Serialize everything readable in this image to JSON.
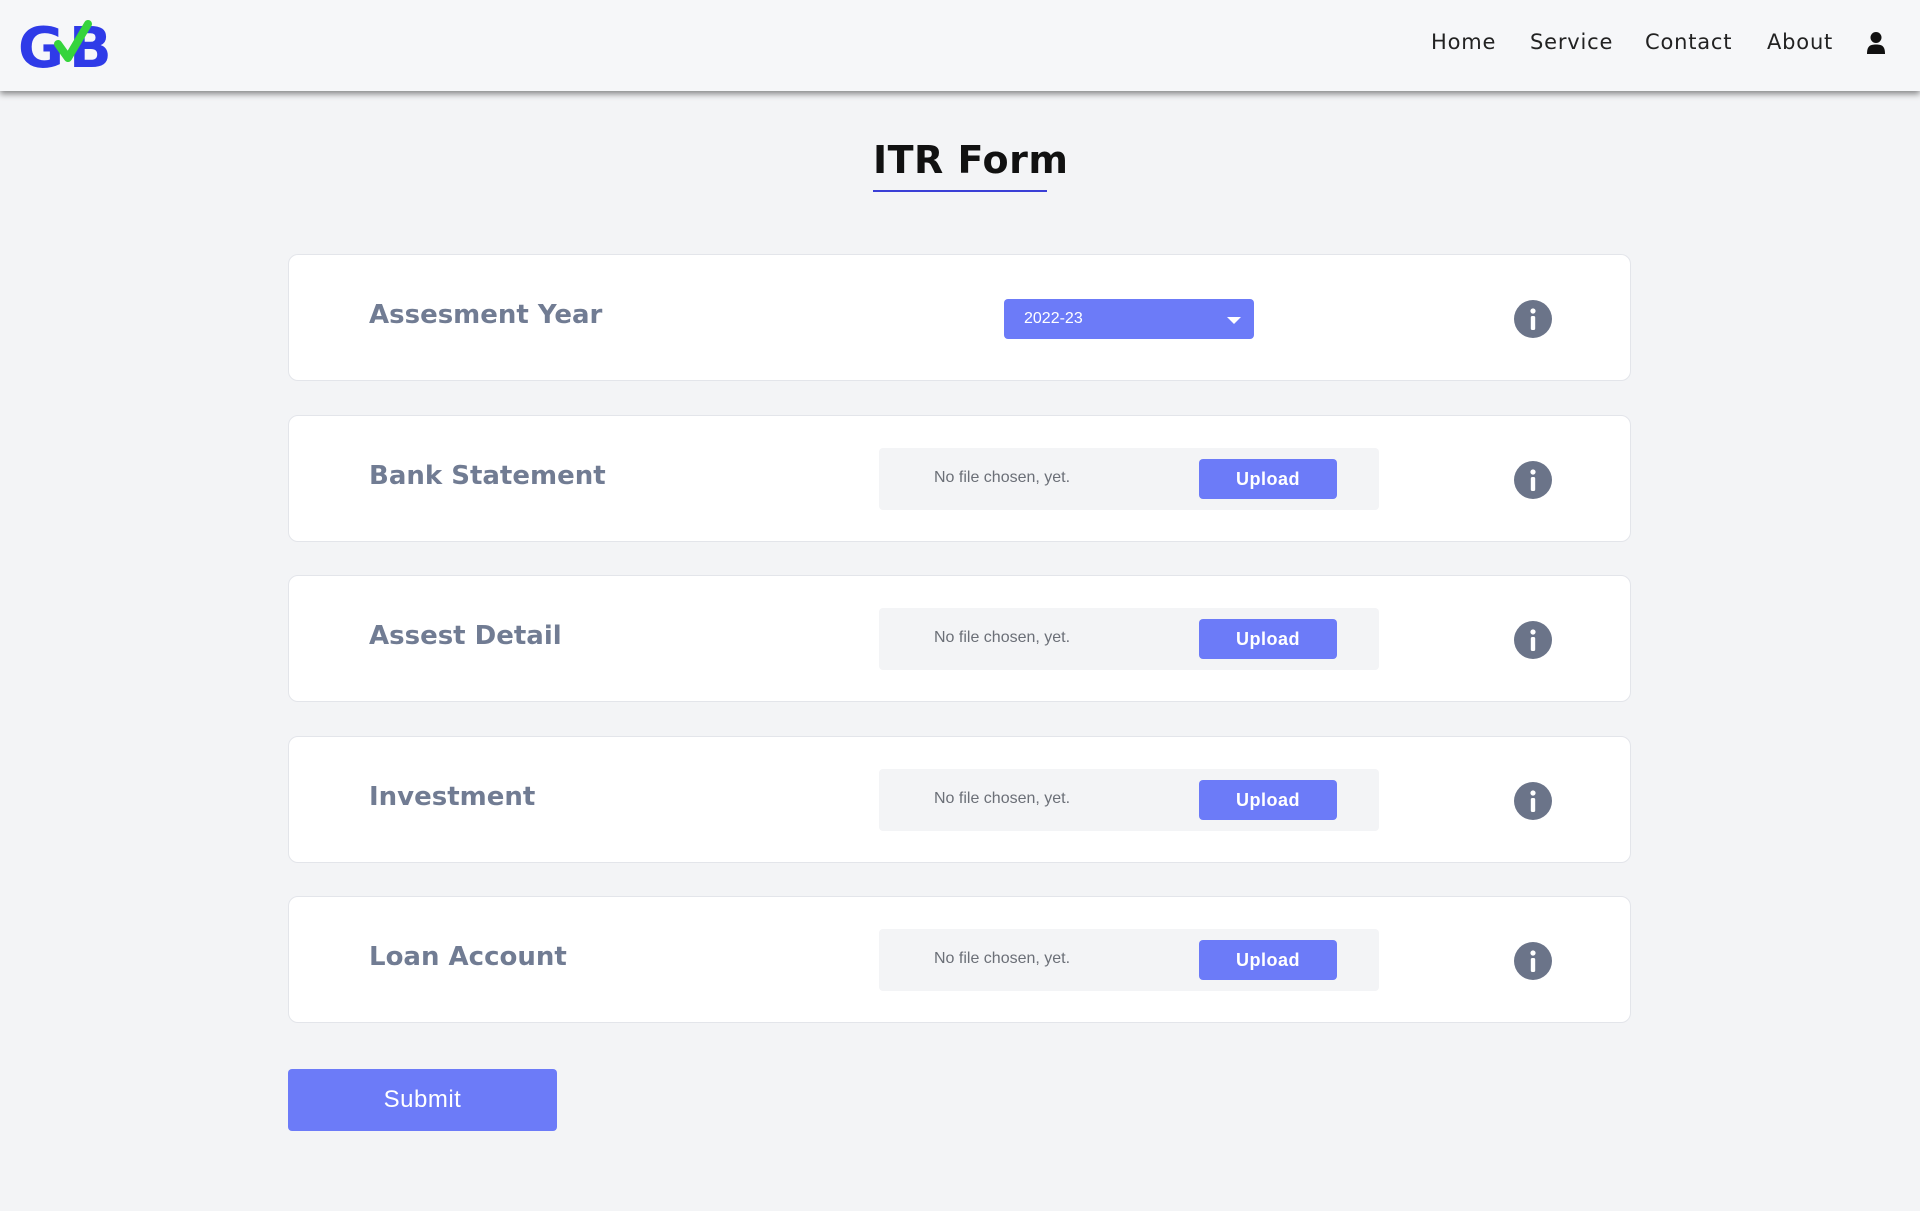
{
  "brand": {
    "logo_text": "GB",
    "colors": {
      "primary": "#2f3be8",
      "accent": "#35d43c"
    }
  },
  "nav": {
    "items": [
      {
        "label": "Home"
      },
      {
        "label": "Service"
      },
      {
        "label": "Contact"
      },
      {
        "label": "About"
      }
    ],
    "user_icon": "user-icon"
  },
  "page": {
    "title": "ITR Form"
  },
  "form": {
    "assessment_year": {
      "label": "Assesment Year",
      "selected": "2022-23"
    },
    "uploads": [
      {
        "label": "Bank Statement",
        "file_status": "No file chosen, yet.",
        "button_label": "Upload"
      },
      {
        "label": "Assest Detail",
        "file_status": "No file chosen, yet.",
        "button_label": "Upload"
      },
      {
        "label": "Investment",
        "file_status": "No file chosen, yet.",
        "button_label": "Upload"
      },
      {
        "label": "Loan Account",
        "file_status": "No file chosen, yet.",
        "button_label": "Upload"
      }
    ],
    "info_icon": "info-icon",
    "submit_label": "Submit"
  },
  "colors": {
    "button": "#6c7bf8",
    "label": "#717c93",
    "background": "#f3f4f6",
    "title_underline": "#3a3fd6"
  }
}
